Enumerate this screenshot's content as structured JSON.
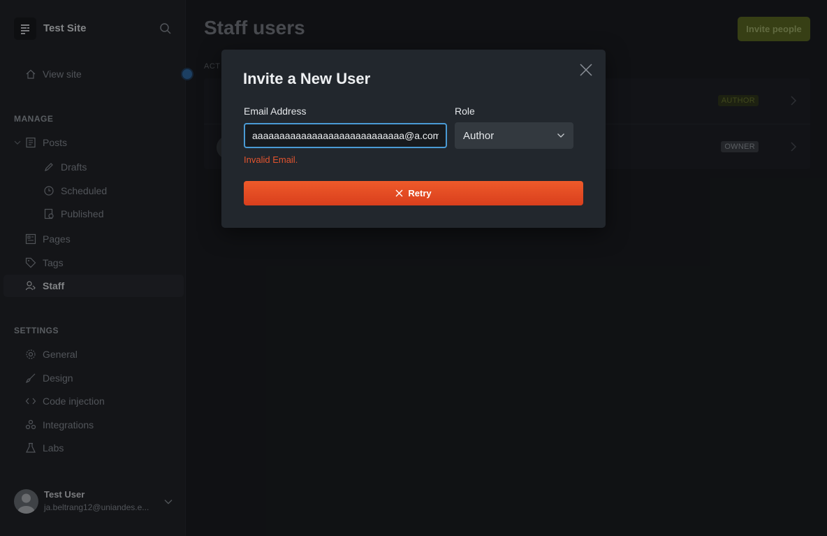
{
  "sidebar": {
    "site_title": "Test Site",
    "view_site": "View site",
    "manage_heading": "MANAGE",
    "settings_heading": "SETTINGS",
    "manage_items": [
      {
        "label": "Posts",
        "icon": "posts-icon"
      },
      {
        "label": "Drafts",
        "icon": "pencil-icon"
      },
      {
        "label": "Scheduled",
        "icon": "clock-icon"
      },
      {
        "label": "Published",
        "icon": "published-icon"
      },
      {
        "label": "Pages",
        "icon": "pages-icon"
      },
      {
        "label": "Tags",
        "icon": "tag-icon"
      },
      {
        "label": "Staff",
        "icon": "staff-icon"
      }
    ],
    "settings_items": [
      {
        "label": "General",
        "icon": "gear-icon"
      },
      {
        "label": "Design",
        "icon": "brush-icon"
      },
      {
        "label": "Code injection",
        "icon": "code-icon"
      },
      {
        "label": "Integrations",
        "icon": "integrations-icon"
      },
      {
        "label": "Labs",
        "icon": "flask-icon"
      }
    ],
    "user": {
      "name": "Test User",
      "email": "ja.beltrang12@uniandes.e..."
    }
  },
  "main": {
    "title": "Staff users",
    "invite_button": "Invite people",
    "active_label": "ACT",
    "rows": [
      {
        "role": "AUTHOR"
      },
      {
        "role": "OWNER"
      }
    ]
  },
  "modal": {
    "title": "Invite a New User",
    "email_label": "Email Address",
    "email_value": "aaaaaaaaaaaaaaaaaaaaaaaaaaaa@a.com",
    "role_label": "Role",
    "role_value": "Author",
    "error": "Invalid Email.",
    "retry_button": "Retry"
  },
  "colors": {
    "accent": "#4a9ad4",
    "danger": "#e2542e",
    "retry": "#e64a22",
    "invite": "#5b6a1c"
  }
}
